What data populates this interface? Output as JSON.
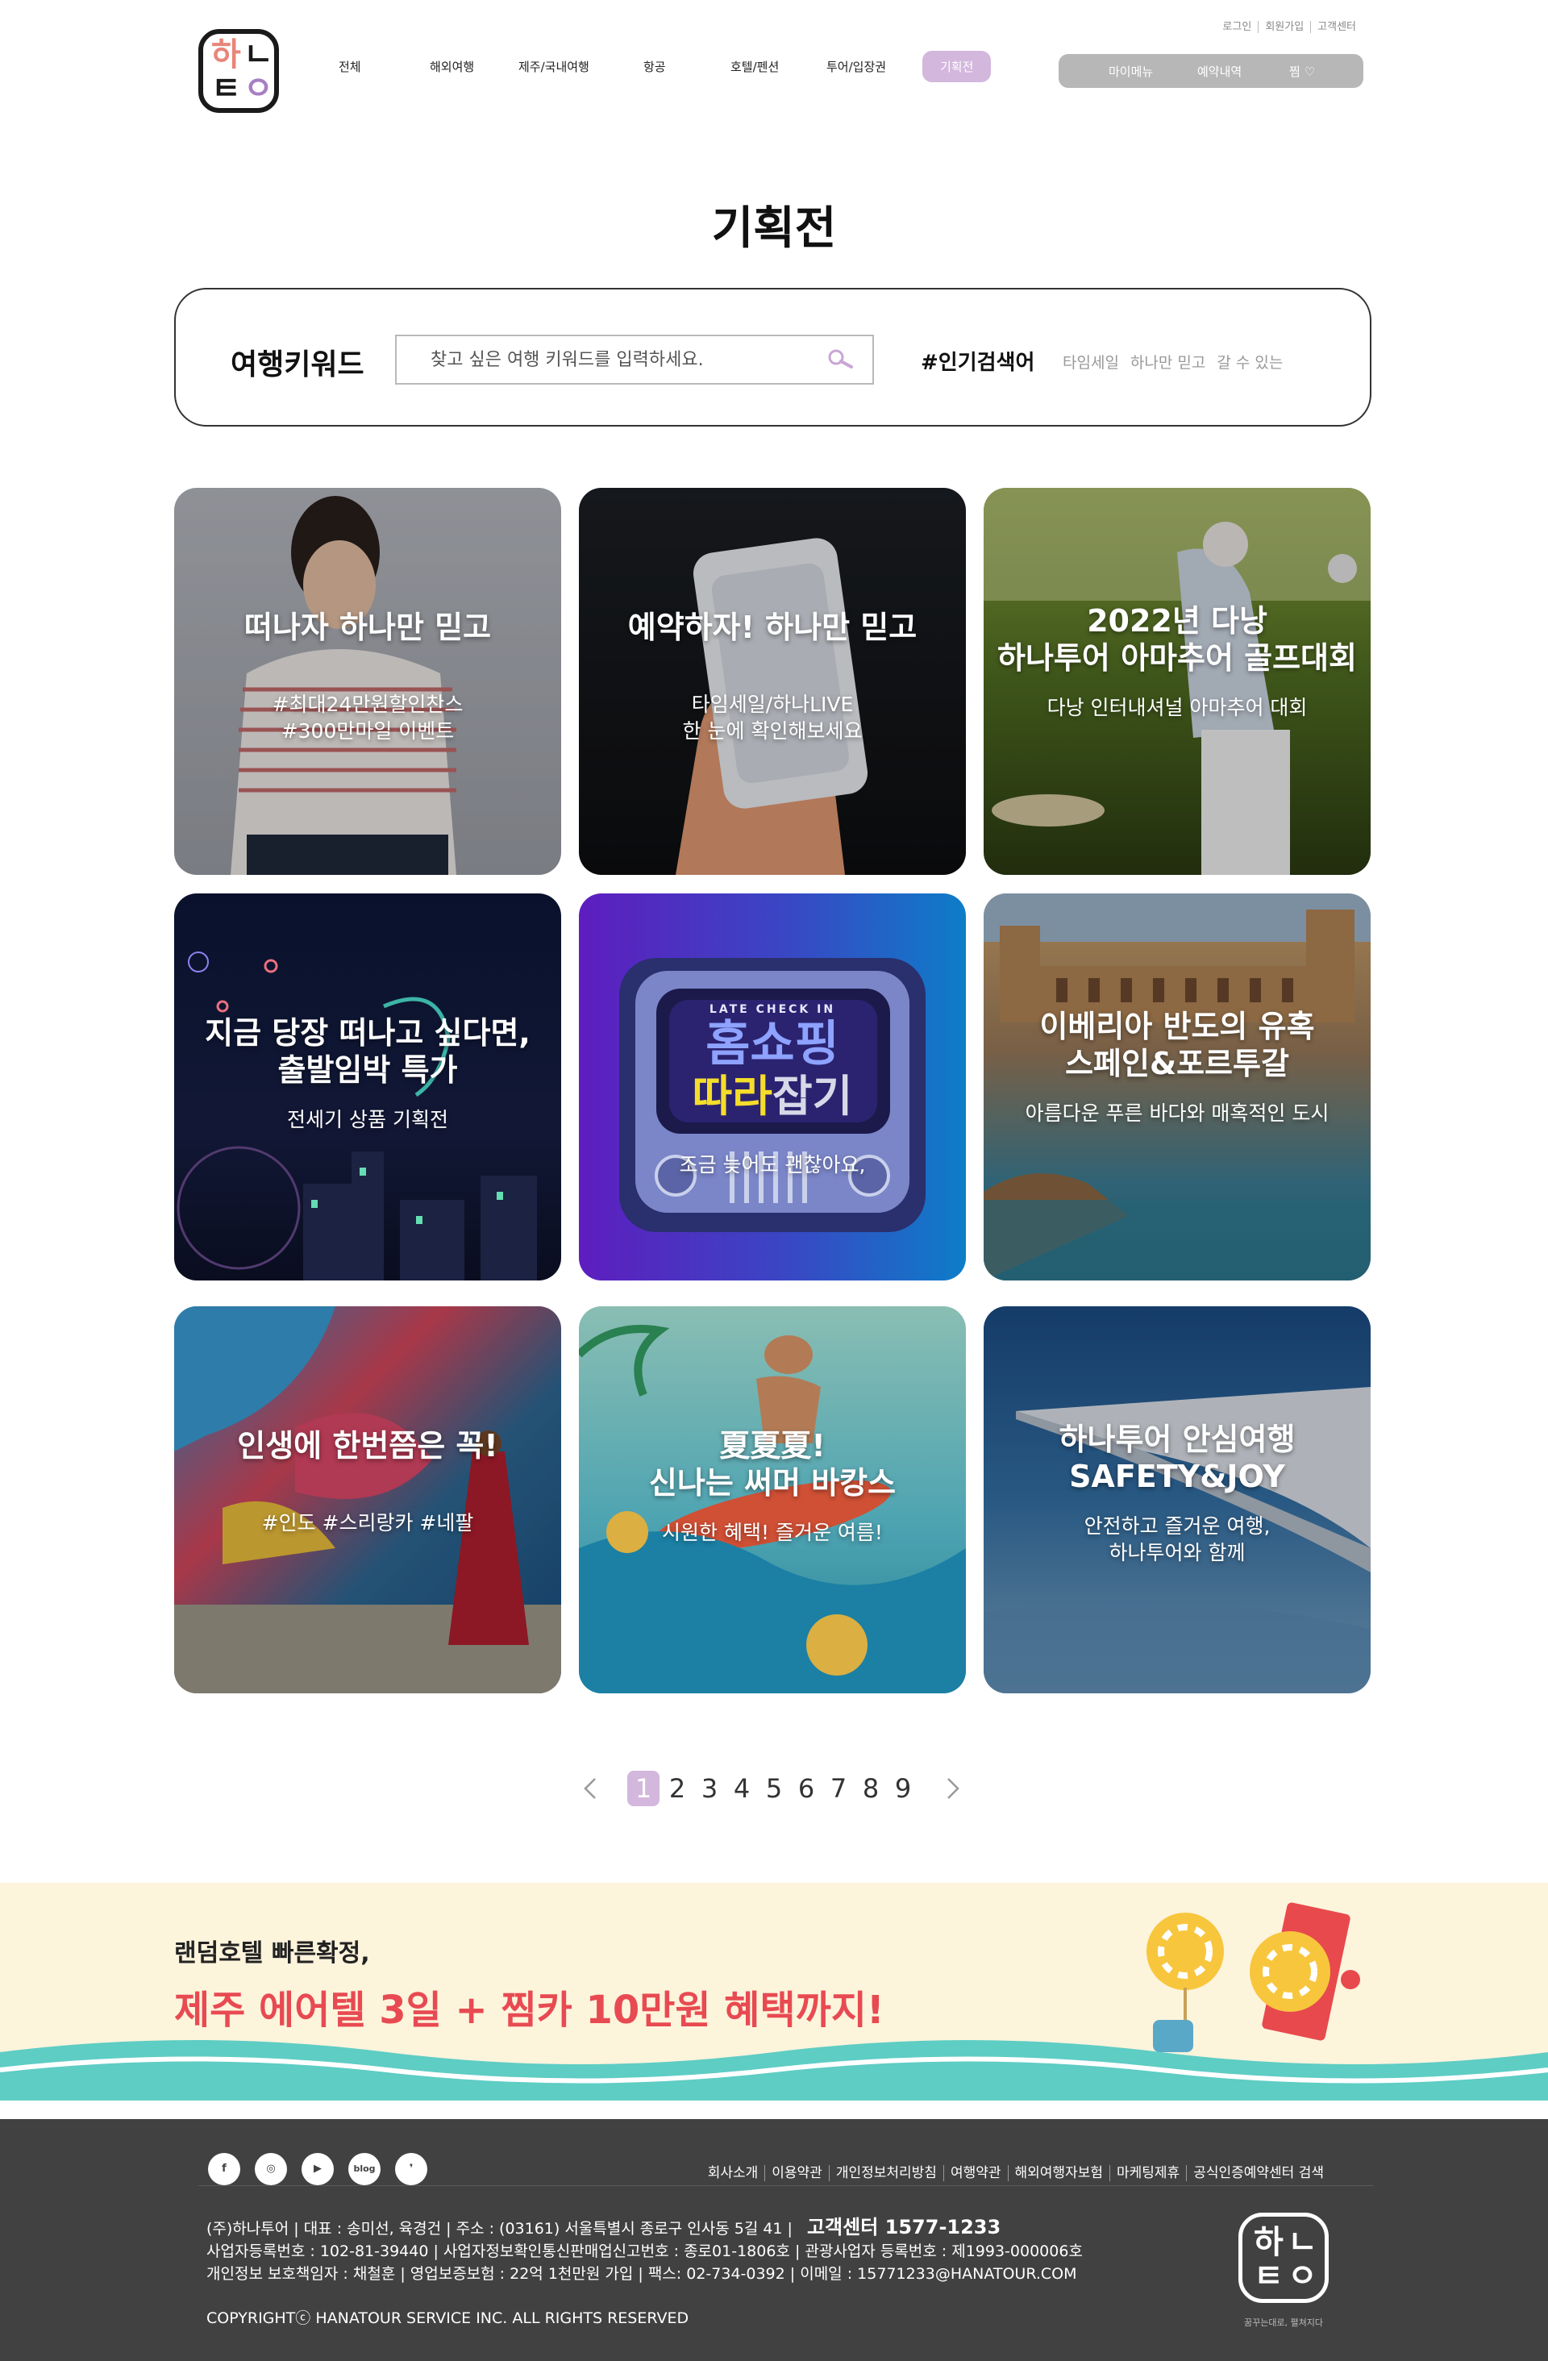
{
  "logo": {
    "glyphs": [
      "하",
      "ㄴ",
      "ㅌ",
      "ㅇ"
    ],
    "icon": "hanatour-logo"
  },
  "gnb": {
    "items": [
      "전체",
      "해외여행",
      "제주/국내여행",
      "항공",
      "호텔/펜션",
      "투어/입장권",
      "기획전"
    ],
    "active_index": 6
  },
  "util_links": [
    "로그인",
    "회원가입",
    "고객센터"
  ],
  "my_panel": {
    "items": [
      "마이메뉴",
      "예약내역",
      "찜 ♡"
    ]
  },
  "page_title": "기획전",
  "search": {
    "label": "여행키워드",
    "placeholder": "찾고 싶은 여행 키워드를 입력하세요.",
    "value": "",
    "icon": "search-icon",
    "hot_label": "#인기검색어",
    "hot_tags": [
      "타임세일",
      "하나만 믿고",
      "갈 수 있는"
    ]
  },
  "cards": [
    {
      "title": [
        "떠나자 하나만 믿고"
      ],
      "sub": [
        "#최대24만원할인찬스",
        "#300만마일 이벤트"
      ]
    },
    {
      "title": [
        "예약하자! 하나만 믿고"
      ],
      "sub": [
        "타임세일/하나LIVE",
        "한 눈에 확인해보세요"
      ]
    },
    {
      "title": [
        "2022년 다낭",
        "하나투어 아마추어 골프대회"
      ],
      "sub": [
        "다낭 인터내셔널 아마추어 대회"
      ]
    },
    {
      "title": [
        "지금 당장 떠나고 싶다면,",
        "출발임박 특가"
      ],
      "sub": [
        "전세기 상품 기획전"
      ]
    },
    {
      "title": [],
      "sub": [
        "조금 늦어도 괜찮아요,"
      ],
      "tv": {
        "top": "LATE CHECK IN",
        "main": "홈쇼핑",
        "bottom_left": "따라",
        "bottom_right": "잡기"
      }
    },
    {
      "title": [
        "이베리아 반도의 유혹",
        "스페인&포르투갈"
      ],
      "sub": [
        "아름다운 푸른 바다와 매혹적인 도시"
      ]
    },
    {
      "title": [
        "인생에 한번쯤은 꼭!"
      ],
      "sub": [
        "#인도 #스리랑카 #네팔"
      ]
    },
    {
      "title": [
        "夏夏夏!",
        "신나는 써머 바캉스"
      ],
      "sub": [
        "시원한 혜택! 즐거운 여름!"
      ]
    },
    {
      "title": [
        "하나투어 안심여행",
        "SAFETY&JOY"
      ],
      "sub": [
        "안전하고 즐거운 여행,",
        "하나투어와 함께"
      ]
    }
  ],
  "pagination": {
    "pages": [
      "1",
      "2",
      "3",
      "4",
      "5",
      "6",
      "7",
      "8",
      "9"
    ],
    "current": "1"
  },
  "promo": {
    "sub": "랜덤호텔 빠른확정,",
    "main": "제주 에어텔 3일 + 찜카 10만원 혜택까지!",
    "colors": {
      "bg": "#fdf4dc",
      "wave": "#5ecdc4",
      "accent": "#e84a52"
    }
  },
  "footer": {
    "sns": [
      "facebook-icon",
      "instagram-icon",
      "youtube-icon",
      "blog-icon",
      "kakao-story-icon"
    ],
    "sns_labels": [
      "f",
      "◎",
      "▶",
      "blog",
      "❜"
    ],
    "links": [
      "회사소개",
      "이용약관",
      "개인정보처리방침",
      "여행약관",
      "해외여행자보험",
      "마케팅제휴",
      "공식인증예약센터 검색"
    ],
    "info_line1": "(주)하나투어 | 대표 : 송미선, 육경건 | 주소 : (03161) 서울특별시 종로구 인사동 5길 41 |",
    "cs_center": "고객센터 1577-1233",
    "info_line2": "사업자등록번호 : 102-81-39440 | 사업자정보확인통신판매업신고번호 : 종로01-1806호 | 관광사업자 등록번호 : 제1993-000006호",
    "info_line3": "개인정보 보호책임자 : 채철훈 | 영업보증보험 : 22억 1천만원 가입 | 팩스: 02-734-0392 | 이메일 : 15771233@HANATOUR.COM",
    "copyright": "COPYRIGHTⓒ HANATOUR SERVICE INC. ALL RIGHTS RESERVED",
    "slogan": "꿈꾸는대로, 펼쳐지다"
  },
  "colors": {
    "accent": "#d3b7dd",
    "footer_bg": "#414141",
    "panel_bg": "#b7b7b7"
  }
}
